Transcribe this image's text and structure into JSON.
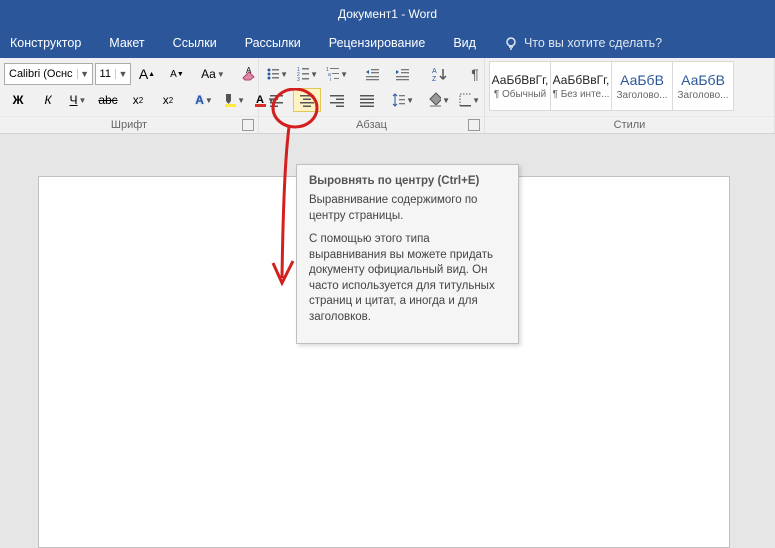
{
  "title": "Документ1  -  Word",
  "tabs": {
    "design": "Конструктор",
    "layout": "Макет",
    "references": "Ссылки",
    "mailings": "Рассылки",
    "review": "Рецензирование",
    "view": "Вид",
    "tellme": "Что вы хотите сделать?"
  },
  "font": {
    "name": "Calibri (Оснс",
    "size": "11",
    "grow": "A",
    "shrink": "A",
    "case": "Aa",
    "bold": "Ж",
    "italic": "К",
    "underline": "Ч",
    "strike": "abc",
    "sub": "x",
    "sup": "x",
    "texteffect": "A",
    "group_label": "Шрифт"
  },
  "para": {
    "group_label": "Абзац"
  },
  "styles": {
    "group_label": "Стили",
    "preview": "АаБбВвГг,",
    "preview_blue": "АаБбВ",
    "names": [
      "¶ Обычный",
      "¶ Без инте...",
      "Заголово...",
      "Заголово..."
    ]
  },
  "tooltip": {
    "title": "Выровнять по центру (Ctrl+E)",
    "p1": "Выравнивание содержимого по центру страницы.",
    "p2": "С помощью этого типа выравнивания вы можете придать документу официальный вид. Он часто используется для титульных страниц и цитат, а иногда и для заголовков."
  }
}
